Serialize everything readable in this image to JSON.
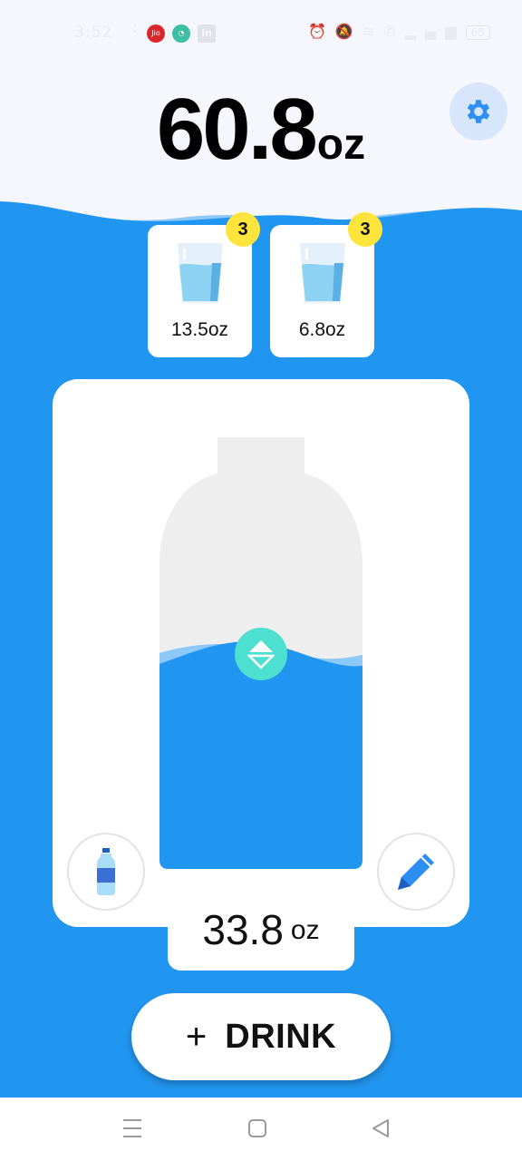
{
  "status_bar": {
    "time": "3:52",
    "icons": [
      "dots-icon",
      "jio-icon",
      "chat-icon",
      "linkedin-icon",
      "alarm-icon",
      "mute-icon",
      "wifi-icon",
      "call-icon",
      "signal-icon",
      "battery-icon"
    ],
    "jio_label": "Jio",
    "linkedin_label": "in",
    "battery_level": "65"
  },
  "header": {
    "total_value": "60.8",
    "total_unit": "oz",
    "settings_icon": "gear-icon"
  },
  "cups": [
    {
      "label": "13.5oz",
      "count": "3",
      "icon": "glass-icon"
    },
    {
      "label": "6.8oz",
      "count": "3",
      "icon": "glass-icon"
    }
  ],
  "bottle": {
    "fill_fraction": 0.65,
    "handle_icon": "up-down-arrows-icon"
  },
  "container": {
    "amount_value": "33.8",
    "amount_unit": "oz",
    "left_icon": "water-bottle-icon",
    "right_icon": "pencil-icon"
  },
  "drink_button": {
    "plus": "+",
    "label": "DRINK"
  },
  "nav": {
    "items": [
      "menu-icon",
      "home-icon",
      "back-icon"
    ]
  },
  "colors": {
    "water": "#2196f0",
    "light_water": "#8cc8f8",
    "badge": "#ffe53b",
    "handle": "#4de0d0",
    "settings_bg": "#d7e6fb",
    "background": "#f6f7fc"
  }
}
